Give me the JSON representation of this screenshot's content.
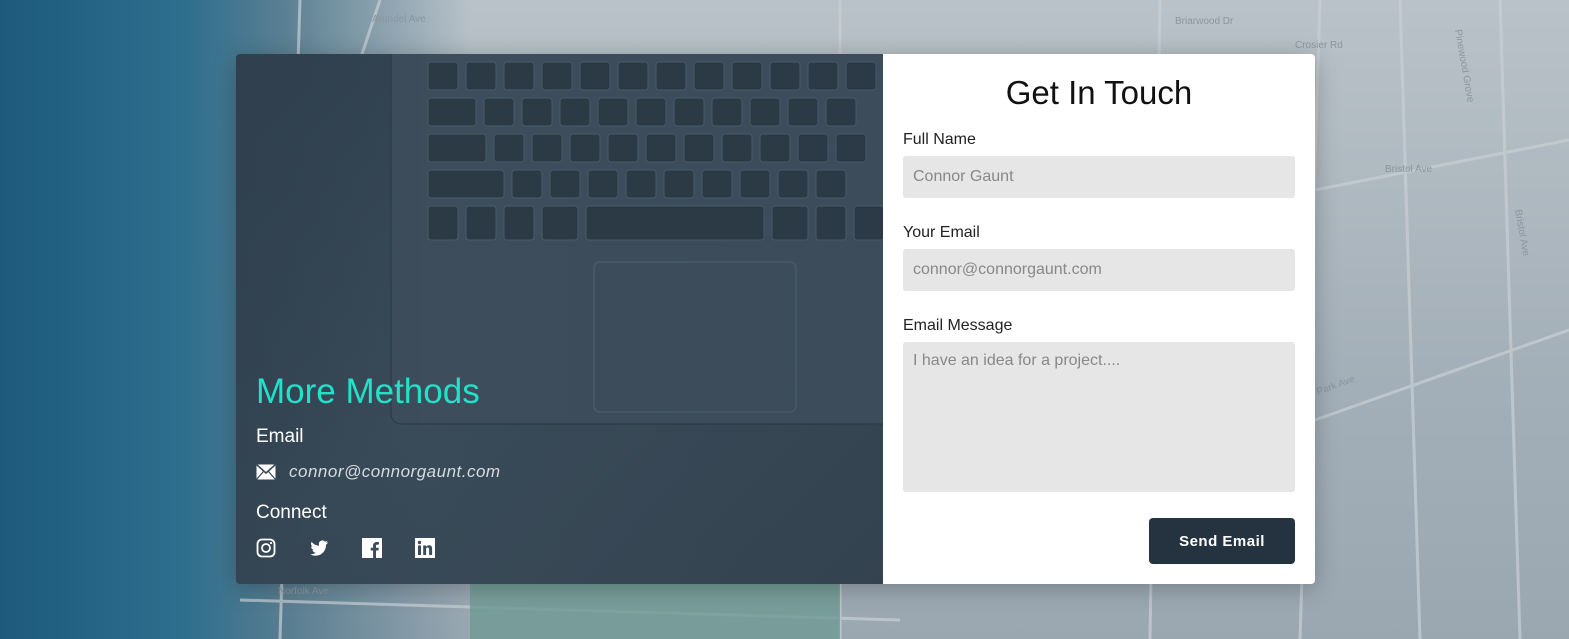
{
  "left_panel": {
    "heading": "More Methods",
    "email_heading": "Email",
    "email_address": "connor@connorgaunt.com",
    "connect_heading": "Connect",
    "social_icons": [
      "instagram-icon",
      "twitter-icon",
      "facebook-icon",
      "linkedin-icon"
    ],
    "accent_color": "#23e0c8"
  },
  "form": {
    "title": "Get In Touch",
    "full_name": {
      "label": "Full Name",
      "placeholder": "Connor Gaunt",
      "value": ""
    },
    "email": {
      "label": "Your Email",
      "placeholder": "connor@connorgaunt.com",
      "value": ""
    },
    "message": {
      "label": "Email Message",
      "placeholder": "I have an idea for a project....",
      "value": ""
    },
    "submit_label": "Send Email",
    "button_color": "#253341"
  },
  "background_map": {
    "street_labels": [
      "Arundel Ave",
      "Briarwood Dr",
      "Crosier Rd",
      "Bristol Ave",
      "Bristol Ave",
      "Park Ave",
      "Norfolk Ave",
      "Pinewood Grove"
    ]
  }
}
